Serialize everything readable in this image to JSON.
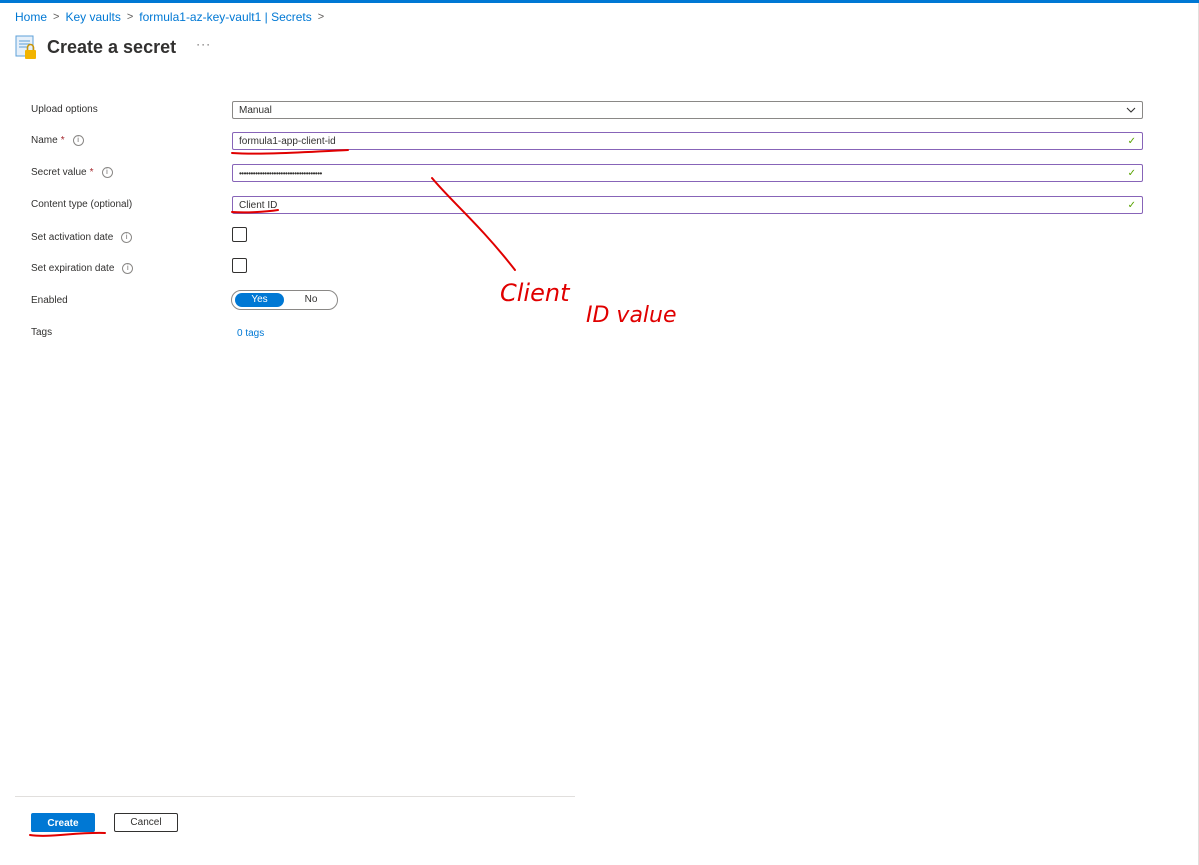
{
  "breadcrumb": [
    {
      "label": "Home"
    },
    {
      "label": "Key vaults"
    },
    {
      "label": "formula1-az-key-vault1 | Secrets"
    }
  ],
  "page": {
    "title": "Create a secret",
    "more": "···"
  },
  "form": {
    "upload_options": {
      "label": "Upload options",
      "value": "Manual"
    },
    "name": {
      "label": "Name",
      "required": "*",
      "value": "formula1-app-client-id"
    },
    "secret_value": {
      "label": "Secret value",
      "required": "*",
      "value": "••••••••••••••••••••••••••••••••••••"
    },
    "content_type": {
      "label": "Content type (optional)",
      "value": "Client ID"
    },
    "activation_date": {
      "label": "Set activation date"
    },
    "expiration_date": {
      "label": "Set expiration date"
    },
    "enabled": {
      "label": "Enabled",
      "on_label": "Yes",
      "off_label": "No",
      "selected": "Yes"
    },
    "tags": {
      "label": "Tags",
      "link": "0 tags"
    }
  },
  "actions": {
    "create": "Create",
    "cancel": "Cancel"
  },
  "annotation": {
    "text_line1": "Client",
    "text_line2": "ID value",
    "color": "#e00000"
  },
  "colors": {
    "accent": "#0078d4",
    "valid_border": "#8764b8",
    "valid_check": "#57a300"
  }
}
